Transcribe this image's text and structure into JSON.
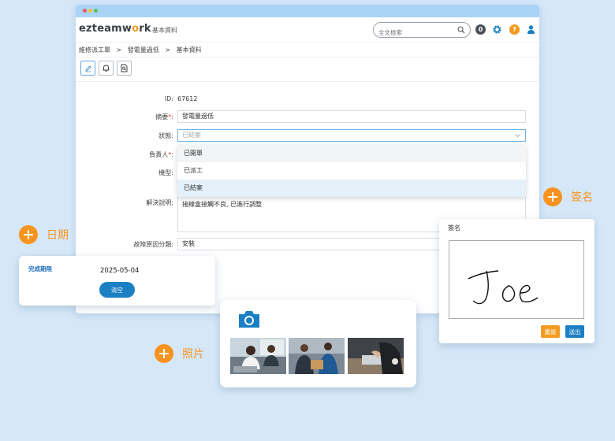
{
  "app": {
    "logo_text": "ezteamw",
    "logo_dot": "o",
    "logo_tail": "rk",
    "page_name": "基本資料",
    "search_placeholder": "全文檢索",
    "badge_count": "0",
    "help_glyph": "?"
  },
  "breadcrumb": [
    "維修派工單",
    ">",
    "發電量過低",
    ">",
    "基本資料"
  ],
  "form": {
    "id_label": "ID:",
    "id_value": "67612",
    "summary_label": "摘要",
    "summary_value": "發電量過低",
    "status_label": "狀態:",
    "status_value": "已結案",
    "owner_label": "負責人",
    "model_label": "機型:",
    "resolution_label": "解決說明:",
    "resolution_value": "接線盒接觸不良, 已進行調整",
    "fault_label": "故障原因分類:",
    "fault_value": "安裝"
  },
  "status_options": [
    "已開單",
    "已派工",
    "已結案"
  ],
  "callouts": {
    "date": "日期",
    "photo": "照片",
    "signature": "簽名"
  },
  "date_card": {
    "label": "完成期限",
    "value": "2025-05-04",
    "clear_label": "清空"
  },
  "signature_card": {
    "title": "簽名",
    "signature_text": "Joe",
    "reset_label": "重設",
    "submit_label": "送出"
  },
  "colors": {
    "accent_orange": "#f7931e",
    "primary_blue": "#1a7fc3",
    "titlebar": "#a9d4f7",
    "background": "#d6e8f8"
  }
}
